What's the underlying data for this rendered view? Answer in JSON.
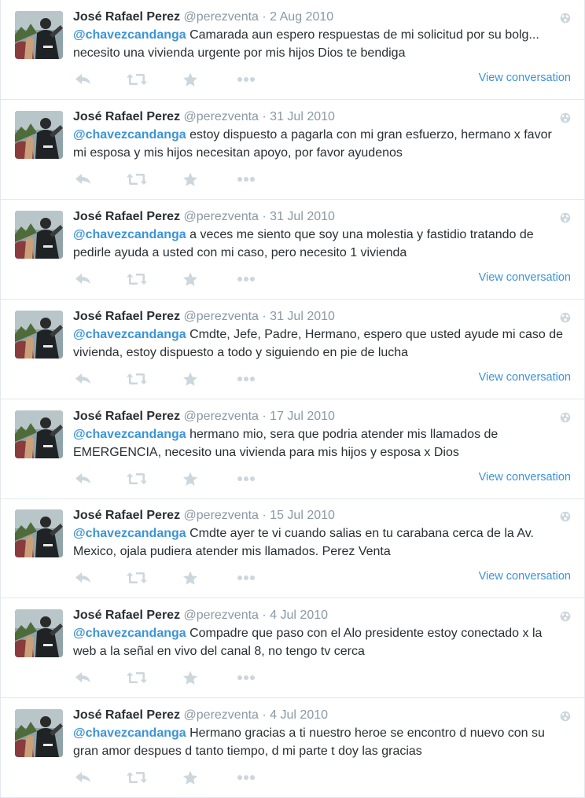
{
  "colors": {
    "link": "#3b94d9",
    "meta": "#8899a6",
    "icon": "#ccd6dd",
    "border": "#e1e8ed"
  },
  "icons": {
    "reply": "reply-icon",
    "retweet": "retweet-icon",
    "favorite": "star-icon",
    "more": "more-icon",
    "visibility": "globe-icon"
  },
  "tweets": [
    {
      "name": "José Rafael Perez",
      "handle": "@perezventa",
      "sep": "·",
      "date": "2 Aug 2010",
      "mention": "@chavezcandanga",
      "text": " Camarada aun espero respuestas de mi solicitud por su bolg... necesito una vivienda urgente por mis hijos Dios te bendiga",
      "view_conversation": "View conversation"
    },
    {
      "name": "José Rafael Perez",
      "handle": "@perezventa",
      "sep": "·",
      "date": "31 Jul 2010",
      "mention": "@chavezcandanga",
      "text": " estoy dispuesto a pagarla con mi gran esfuerzo, hermano x favor mi esposa y mis hijos necesitan apoyo, por favor ayudenos",
      "view_conversation": ""
    },
    {
      "name": "José Rafael Perez",
      "handle": "@perezventa",
      "sep": "·",
      "date": "31 Jul 2010",
      "mention": "@chavezcandanga",
      "text": " a veces me siento que soy una molestia y fastidio tratando de pedirle ayuda a usted con mi caso, pero necesito 1 vivienda",
      "view_conversation": "View conversation"
    },
    {
      "name": "José Rafael Perez",
      "handle": "@perezventa",
      "sep": "·",
      "date": "31 Jul 2010",
      "mention": "@chavezcandanga",
      "text": " Cmdte, Jefe, Padre, Hermano, espero que usted ayude mi caso de vivienda, estoy dispuesto a todo y siguiendo en pie de lucha",
      "view_conversation": "View conversation"
    },
    {
      "name": "José Rafael Perez",
      "handle": "@perezventa",
      "sep": "·",
      "date": "17 Jul 2010",
      "mention": "@chavezcandanga",
      "text": " hermano mio, sera que podria atender mis llamados de EMERGENCIA, necesito una vivienda para mis hijos y esposa x Dios",
      "view_conversation": "View conversation"
    },
    {
      "name": "José Rafael Perez",
      "handle": "@perezventa",
      "sep": "·",
      "date": "15 Jul 2010",
      "mention": "@chavezcandanga",
      "text": " Cmdte ayer te vi cuando salias en tu carabana cerca de la Av. Mexico, ojala pudiera atender mis llamados. Perez Venta",
      "view_conversation": "View conversation"
    },
    {
      "name": "José Rafael Perez",
      "handle": "@perezventa",
      "sep": "·",
      "date": "4 Jul 2010",
      "mention": "@chavezcandanga",
      "text": " Compadre que paso con el Alo presidente estoy conectado x la web a la señal en vivo del canal 8, no tengo tv cerca",
      "view_conversation": ""
    },
    {
      "name": "José Rafael Perez",
      "handle": "@perezventa",
      "sep": "·",
      "date": "4 Jul 2010",
      "mention": "@chavezcandanga",
      "text": " Hermano gracias a ti nuestro heroe se encontro d nuevo con su gran amor despues d tanto tiempo, d mi parte t doy las gracias",
      "view_conversation": ""
    }
  ]
}
